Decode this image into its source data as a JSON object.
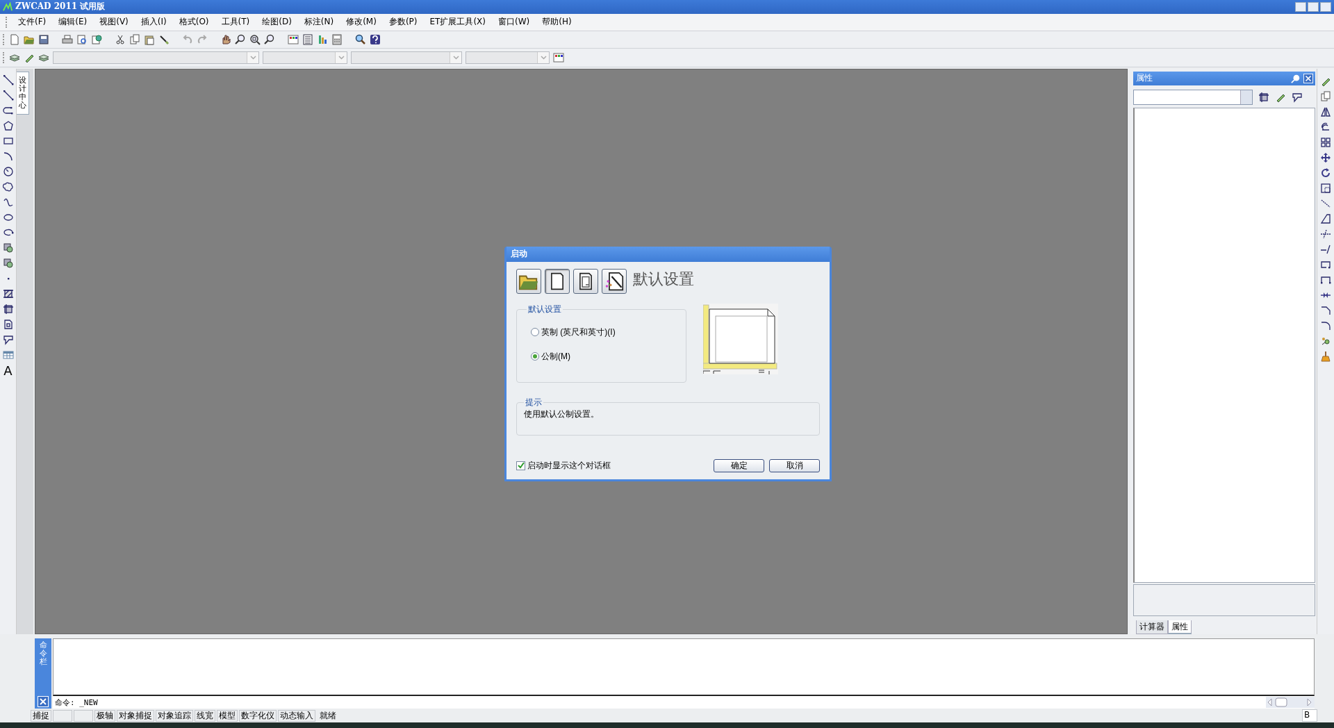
{
  "window": {
    "title": "ZWCAD 2011 试用版"
  },
  "menu": [
    "文件(F)",
    "编辑(E)",
    "视图(V)",
    "插入(I)",
    "格式(O)",
    "工具(T)",
    "绘图(D)",
    "标注(N)",
    "修改(M)",
    "参数(P)",
    "ET扩展工具(X)",
    "窗口(W)",
    "帮助(H)"
  ],
  "left_toolbar": {
    "text_tool": "A"
  },
  "design_center_tab": {
    "label": "设计中心"
  },
  "dialog": {
    "title": "启动",
    "heading": "默认设置",
    "mode_buttons": [
      {
        "kind": "open",
        "selected": false
      },
      {
        "kind": "default",
        "selected": true
      },
      {
        "kind": "template",
        "selected": false
      },
      {
        "kind": "wizard",
        "selected": false
      }
    ],
    "units": {
      "label": "默认设置",
      "options": [
        {
          "label": "英制 (英尺和英寸)(I)",
          "selected": false
        },
        {
          "label": "公制(M)",
          "selected": true
        }
      ]
    },
    "hint": {
      "label": "提示",
      "text": "使用默认公制设置。"
    },
    "show_on_startup": {
      "label": "启动时显示这个对话框",
      "checked": true
    },
    "buttons": [
      "确定",
      "取消"
    ]
  },
  "properties_panel": {
    "title": "属性",
    "tabs": [
      {
        "label": "计算器",
        "selected": false
      },
      {
        "label": "属性",
        "selected": true
      }
    ]
  },
  "command_panel": {
    "label": "命令栏",
    "prompt": "命令: _NEW"
  },
  "status_bar": {
    "left_items": [
      "捕捉"
    ],
    "items": [
      "极轴",
      "对象捕捉",
      "对象追踪",
      "线宽",
      "模型",
      "数字化仪",
      "动态输入"
    ],
    "status": "就绪",
    "right_box": "B"
  }
}
